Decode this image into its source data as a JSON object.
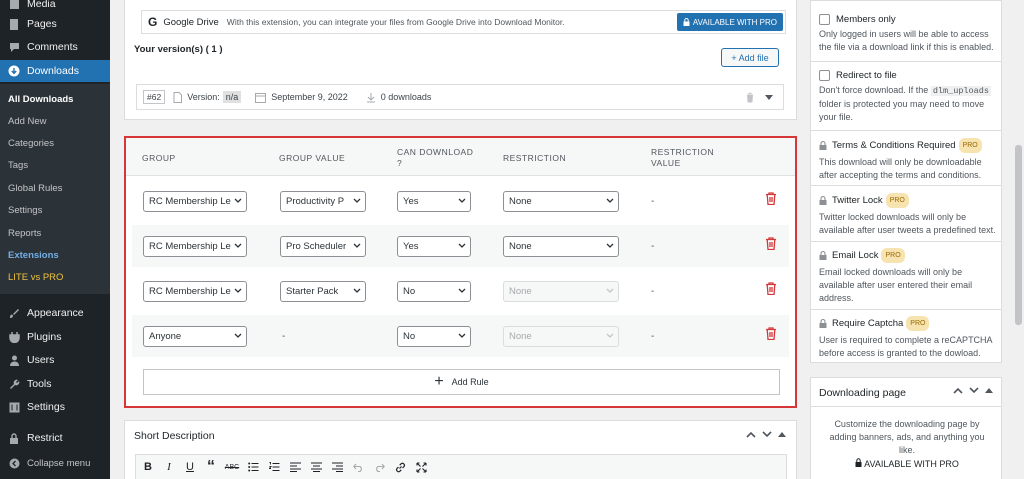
{
  "sidebar": {
    "media": "Media",
    "pages": "Pages",
    "comments": "Comments",
    "downloads": "Downloads",
    "submenu": [
      "All Downloads",
      "Add New",
      "Categories",
      "Tags",
      "Global Rules",
      "Settings",
      "Reports",
      "Extensions",
      "LITE vs PRO"
    ],
    "appearance": "Appearance",
    "plugins": "Plugins",
    "users": "Users",
    "tools": "Tools",
    "settings": "Settings",
    "restrict": "Restrict",
    "collapse": "Collapse menu"
  },
  "extension": {
    "name": "Google Drive",
    "description": "With this extension, you can integrate your files from Google Drive into Download Monitor.",
    "pro_button": "AVAILABLE WITH PRO"
  },
  "versions": {
    "title": "Your version(s) ( 1 )",
    "add_file": "+ Add file",
    "id": "#62",
    "version_label": "Version:",
    "version_value": "n/a",
    "date": "September 9, 2022",
    "downloads": "0 downloads"
  },
  "rules": {
    "headers": {
      "group": "GROUP",
      "group_value": "GROUP VALUE",
      "can_download": "CAN DOWNLOAD\n?",
      "restriction": "RESTRICTION",
      "restriction_value": "RESTRICTION\nVALUE"
    },
    "rows": [
      {
        "group": "RC Membership Le",
        "value": "Productivity P",
        "can": "Yes",
        "restriction": "None",
        "restriction_value": "-"
      },
      {
        "group": "RC Membership Le",
        "value": "Pro Scheduler",
        "can": "Yes",
        "restriction": "None",
        "restriction_value": "-"
      },
      {
        "group": "RC Membership Le",
        "value": "Starter Pack",
        "can": "No",
        "restriction": "None",
        "restriction_value": "-"
      },
      {
        "group": "Anyone",
        "value": "-",
        "can": "No",
        "restriction": "None",
        "restriction_value": "-"
      }
    ],
    "add_rule": "Add Rule"
  },
  "short_description": {
    "title": "Short Description",
    "toolbar": [
      "B",
      "I",
      "U",
      "“",
      "ABC"
    ]
  },
  "options": {
    "members_only": "Members only",
    "members_only_desc": "Only logged in users will be able to access the file via a download link if this is enabled.",
    "redirect": "Redirect to file",
    "redirect_desc_1": "Don't force download. If the",
    "redirect_code": "dlm_uploads",
    "redirect_desc_2": "folder is protected you may need to move your file.",
    "terms": "Terms & Conditions Required",
    "terms_desc": "This download will only be downloadable after accepting the terms and conditions.",
    "twitter": "Twitter Lock",
    "twitter_desc": "Twitter locked downloads will only be available after user tweets a predefined text.",
    "email": "Email Lock",
    "email_desc": "Email locked downloads will only be available after user entered their email address.",
    "captcha": "Require Captcha",
    "captcha_desc": "User is required to complete a reCAPTCHA before access is granted to the dowload.",
    "pro": "PRO"
  },
  "downloading_page": {
    "title": "Downloading page",
    "desc": "Customize the downloading page by adding banners, ads, and anything you like.",
    "avail": "AVAILABLE WITH PRO"
  },
  "colors": {
    "sidebar_bg": "#1d2327",
    "accent": "#2271b1",
    "danger": "#d63638",
    "pro_badge": "#f6e3b0"
  }
}
